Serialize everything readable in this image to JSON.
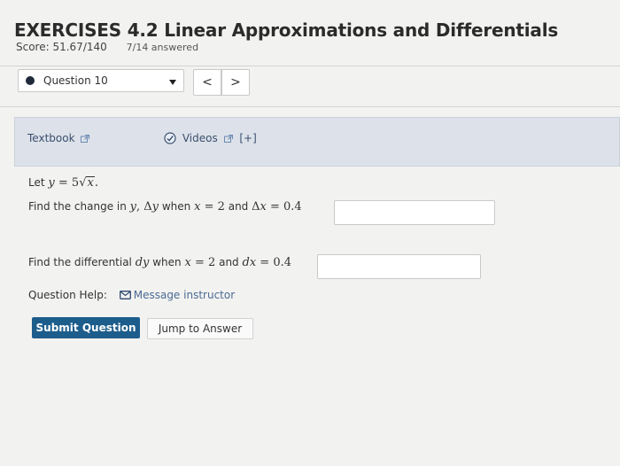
{
  "header": {
    "title": "EXERCISES 4.2 Linear Approximations and Differentials",
    "score": "Score: 51.67/140",
    "answered": "7/14 answered"
  },
  "question_nav": {
    "selected": "Question 10",
    "prev_label": "<",
    "next_label": ">"
  },
  "resources": {
    "textbook_label": "Textbook",
    "videos_label": "Videos",
    "expand_label": "[+]"
  },
  "problem": {
    "let_prefix": "Let",
    "prompt1_prefix": "Find the change in",
    "prompt1_when": "when",
    "prompt1_and": "and",
    "answer1_value": "",
    "prompt2_prefix": "Find the differential",
    "prompt2_when": "when",
    "prompt2_and": "and",
    "answer2_value": ""
  },
  "help": {
    "label": "Question Help:",
    "message_label": "Message instructor"
  },
  "actions": {
    "submit_label": "Submit Question",
    "jump_label": "Jump to Answer"
  },
  "colors": {
    "submit_bg": "#1d5d8c",
    "toolbar_bg": "#dde2ea",
    "link": "#3a4f6d"
  }
}
